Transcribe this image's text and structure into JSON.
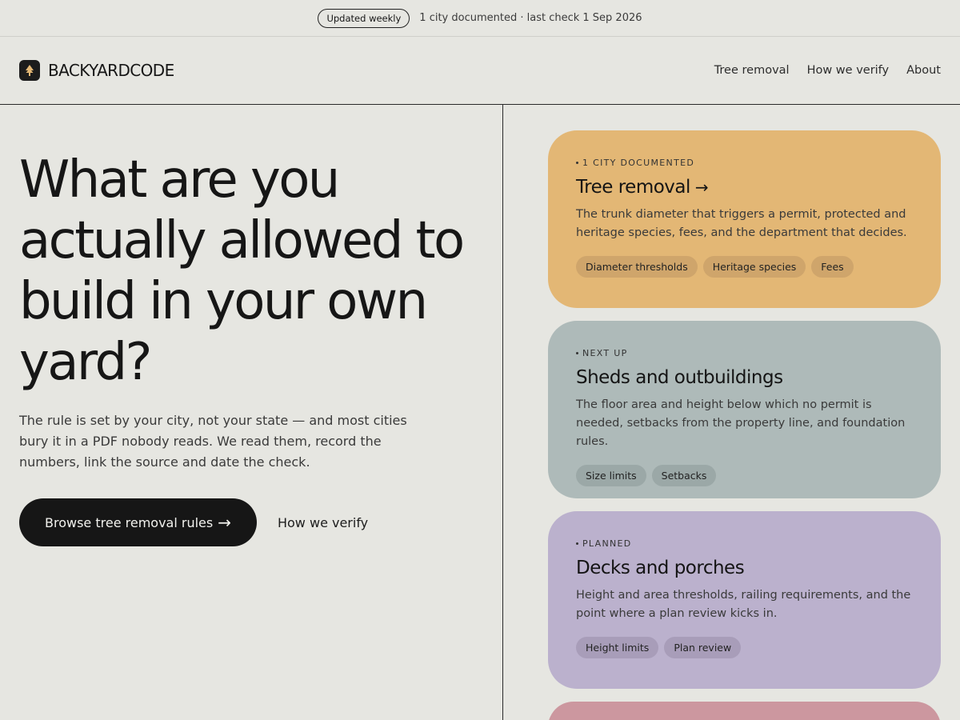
{
  "topbar": {
    "badge": "Updated weekly",
    "status": "1 city documented · last check 1 Sep 2026"
  },
  "header": {
    "brand": "BACKYARDCODE",
    "nav": [
      {
        "label": "Tree removal"
      },
      {
        "label": "How we verify"
      },
      {
        "label": "About"
      }
    ]
  },
  "hero": {
    "title": "What are you actually allowed to build in your own yard?",
    "body": "The rule is set by your city, not your state — and most cities bury it in a PDF nobody reads. We read them, record the numbers, link the source and date the check.",
    "cta_primary": "Browse tree removal rules",
    "cta_secondary": "How we verify"
  },
  "cards": [
    {
      "status": "1 CITY DOCUMENTED",
      "title": "Tree removal",
      "desc": "The trunk diameter that triggers a permit, protected and heritage species, fees, and the department that decides.",
      "tags": [
        "Diameter thresholds",
        "Heritage species",
        "Fees"
      ]
    },
    {
      "status": "NEXT UP",
      "title": "Sheds and outbuildings",
      "desc": "The floor area and height below which no permit is needed, setbacks from the property line, and foundation rules.",
      "tags": [
        "Size limits",
        "Setbacks"
      ]
    },
    {
      "status": "PLANNED",
      "title": "Decks and porches",
      "desc": "Height and area thresholds, railing requirements, and the point where a plan review kicks in.",
      "tags": [
        "Height limits",
        "Plan review"
      ]
    }
  ],
  "colors": {
    "background": "#e6e6e1",
    "card_orange": "#e3b775",
    "card_grey": "#aebab9",
    "card_purple": "#bbb1cd",
    "card_pink": "#cc979f",
    "dark": "#161616"
  },
  "icons": {
    "logo": "tree-icon",
    "arrow": "arrow-right-icon"
  }
}
